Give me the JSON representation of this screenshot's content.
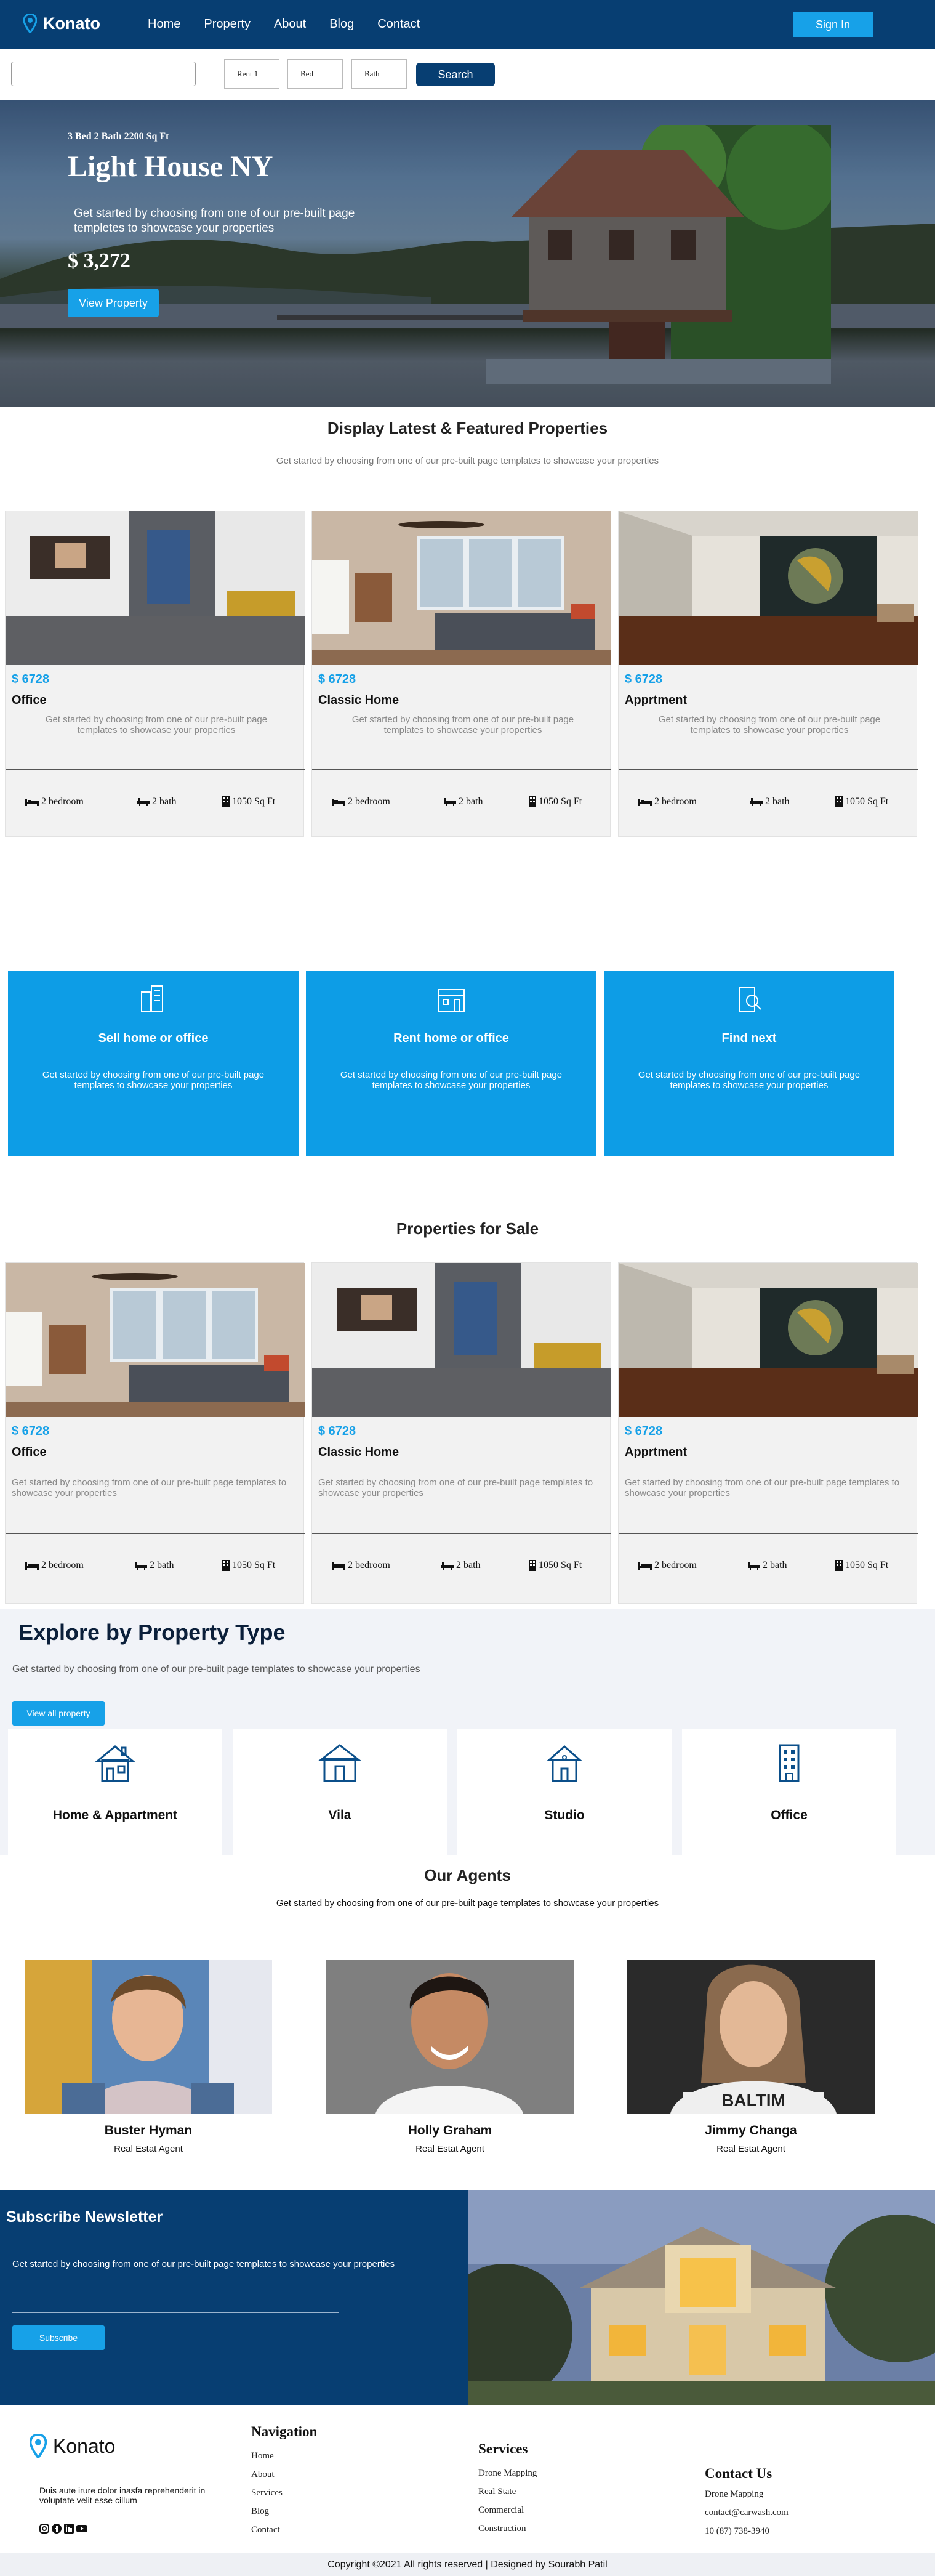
{
  "brand": {
    "name": "Konato"
  },
  "nav": {
    "links": [
      "Home",
      "Property",
      "About",
      "Blog",
      "Contact"
    ],
    "signin": "Sign In"
  },
  "search": {
    "input_value": "",
    "rent": "Rent 1",
    "bed": "Bed",
    "bath": "Bath",
    "button": "Search"
  },
  "hero": {
    "specs": "3 Bed 2 Bath 2200 Sq Ft",
    "title": "Light House NY",
    "desc": "Get started by choosing from one of our pre-built page templetes to showcase your properties",
    "price": "$ 3,272",
    "button": "View Property"
  },
  "featured": {
    "title": "Display Latest & Featured Properties",
    "subtitle": "Get started by choosing from one of our pre-built page templates to showcase your properties",
    "cards": [
      {
        "price": "$ 6728",
        "name": "Office",
        "desc": "Get started by choosing from one of our pre-built page templates to showcase your properties",
        "beds": "2 bedroom",
        "baths": "2 bath",
        "area": "1050 Sq Ft"
      },
      {
        "price": "$ 6728",
        "name": "Classic Home",
        "desc": "Get started by choosing from one of our pre-built page templates to showcase your properties",
        "beds": "2 bedroom",
        "baths": "2 bath",
        "area": "1050 Sq Ft"
      },
      {
        "price": "$ 6728",
        "name": "Apprtment",
        "desc": "Get started by choosing from one of our pre-built page templates to showcase your properties",
        "beds": "2 bedroom",
        "baths": "2 bath",
        "area": "1050 Sq Ft"
      }
    ]
  },
  "services": [
    {
      "title": "Sell home or office",
      "desc": "Get started by choosing from one of our pre-built page templates to showcase your properties",
      "icon": "buildings-icon"
    },
    {
      "title": "Rent home or office",
      "desc": "Get started by choosing from one of our pre-built page templates to showcase your properties",
      "icon": "building-outline-icon"
    },
    {
      "title": "Find next",
      "desc": "Get started by choosing from one of our pre-built page templates to showcase your properties",
      "icon": "building-search-icon"
    }
  ],
  "sale": {
    "title": "Properties for Sale",
    "cards": [
      {
        "price": "$ 6728",
        "name": "Office",
        "desc": "Get started by choosing from one of our pre-built page templates to showcase your properties",
        "beds": "2 bedroom",
        "baths": "2 bath",
        "area": "1050 Sq Ft"
      },
      {
        "price": "$ 6728",
        "name": "Classic Home",
        "desc": "Get started by choosing from one of our pre-built page templates to showcase your properties",
        "beds": "2 bedroom",
        "baths": "2 bath",
        "area": "1050 Sq Ft"
      },
      {
        "price": "$ 6728",
        "name": "Apprtment",
        "desc": "Get started by choosing from one of our pre-built page templates to showcase your properties",
        "beds": "2 bedroom",
        "baths": "2 bath",
        "area": "1050 Sq Ft"
      }
    ]
  },
  "explore": {
    "title": "Explore by Property Type",
    "subtitle": "Get started by choosing from one of our pre-built page templates to showcase your properties",
    "button": "View all property",
    "types": [
      "Home & Appartment",
      "Vila",
      "Studio",
      "Office"
    ]
  },
  "agents": {
    "title": "Our Agents",
    "subtitle": "Get started by choosing from one of our pre-built page templates to showcase your properties",
    "list": [
      {
        "name": "Buster Hyman",
        "role": "Real Estat Agent"
      },
      {
        "name": "Holly Graham",
        "role": "Real Estat Agent"
      },
      {
        "name": "Jimmy Changa",
        "role": "Real Estat Agent"
      }
    ]
  },
  "newsletter": {
    "title": "Subscribe Newsletter",
    "subtitle": "Get started by choosing from one of our pre-built page templates to showcase your properties",
    "placeholder": "",
    "button": "Subscribe"
  },
  "footer": {
    "about": "Duis aute irure dolor inasfa reprehenderit in voluptate velit esse cillum",
    "nav_title": "Navigation",
    "nav_items": [
      "Home",
      "About",
      "Services",
      "Blog",
      "Contact"
    ],
    "services_title": "Services",
    "services_items": [
      "Drone Mapping",
      "Real State",
      "Commercial",
      "Construction"
    ],
    "contact_title": "Contact Us",
    "contact_items": [
      "Drone Mapping",
      "contact@carwash.com",
      "10 (87) 738-3940"
    ],
    "copyright": "Copyright ©2021 All rights reserved | Designed by Sourabh Patil"
  },
  "colors": {
    "navy": "#073e72",
    "accent": "#17a1e8",
    "service_blue": "#0d9de6"
  }
}
